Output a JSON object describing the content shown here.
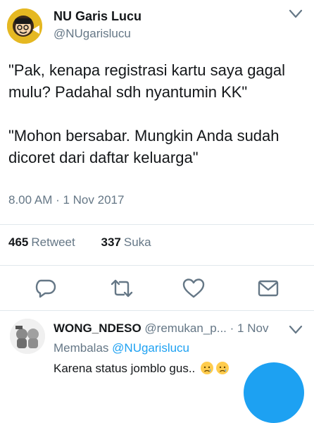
{
  "tweet": {
    "display_name": "NU Garis Lucu",
    "handle": "@NUgarislucu",
    "text": "\"Pak, kenapa registrasi kartu saya gagal mulu? Padahal sdh nyantumin KK\"\n\n\"Mohon bersabar. Mungkin Anda sudah dicoret dari daftar keluarga\"",
    "timestamp": "8.00 AM · 1 Nov 2017",
    "retweet_count": "465",
    "retweet_label": "Retweet",
    "like_count": "337",
    "like_label": "Suka"
  },
  "actions": [
    {
      "icon": "reply-icon"
    },
    {
      "icon": "retweet-icon"
    },
    {
      "icon": "like-icon"
    },
    {
      "icon": "message-icon"
    }
  ],
  "reply": {
    "display_name": "WONG_NDESO",
    "handle": "@remukan_p...",
    "dot": "·",
    "time": "1 Nov",
    "replying_label": "Membalas",
    "replying_to": "@NUgarislucu",
    "text": "Karena status jomblo gus..",
    "emojis": [
      "sad-tear-emoji",
      "sad-tear-emoji"
    ]
  },
  "colors": {
    "accent": "#1da1f2",
    "secondary_text": "#657786",
    "icon": "#657786",
    "divider": "#e1e8ed"
  }
}
